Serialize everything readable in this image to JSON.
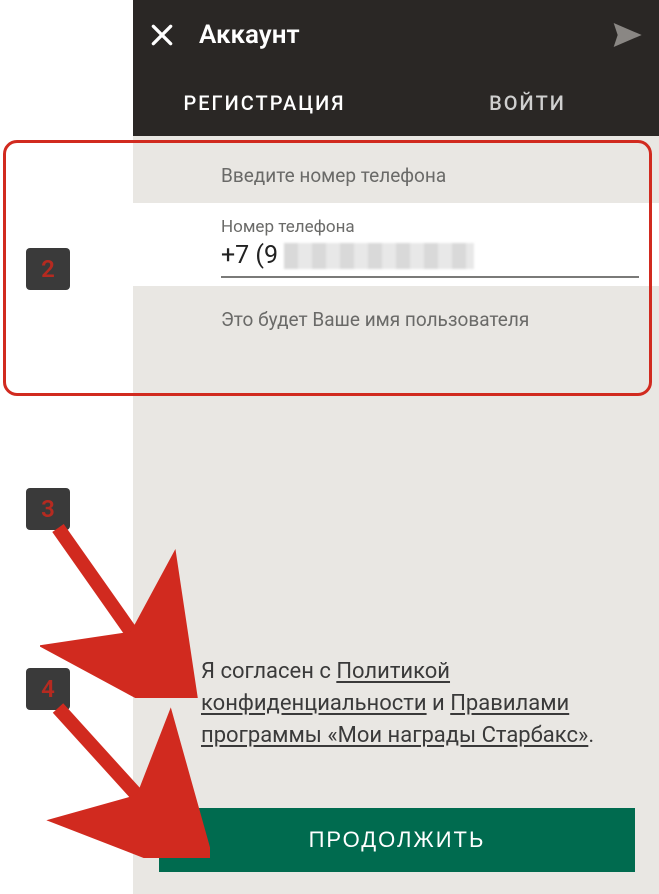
{
  "header": {
    "title": "Аккаунт"
  },
  "tabs": {
    "register": "РЕГИСТРАЦИЯ",
    "login": "ВОЙТИ"
  },
  "form": {
    "prompt_enter": "Введите номер телефона",
    "phone_label": "Номер телефона",
    "phone_prefix": "+7 (9",
    "prompt_username": "Это будет Ваше имя пользователя"
  },
  "consent": {
    "part1": "Я согласен с ",
    "link1": "Политикой конфиденциальности",
    "part2": " и ",
    "link2": "Правилами программы «Мои награды Старбакс»",
    "part3": "."
  },
  "button": {
    "continue": "ПРОДОЛЖИТЬ"
  },
  "annotations": {
    "badge2": "2",
    "badge3": "3",
    "badge4": "4"
  },
  "colors": {
    "header_bg": "#2a2725",
    "accent_green": "#00997a",
    "button_green": "#006b4f",
    "annotation_red": "#d12a1f",
    "badge_bg": "#3a3a3a"
  }
}
